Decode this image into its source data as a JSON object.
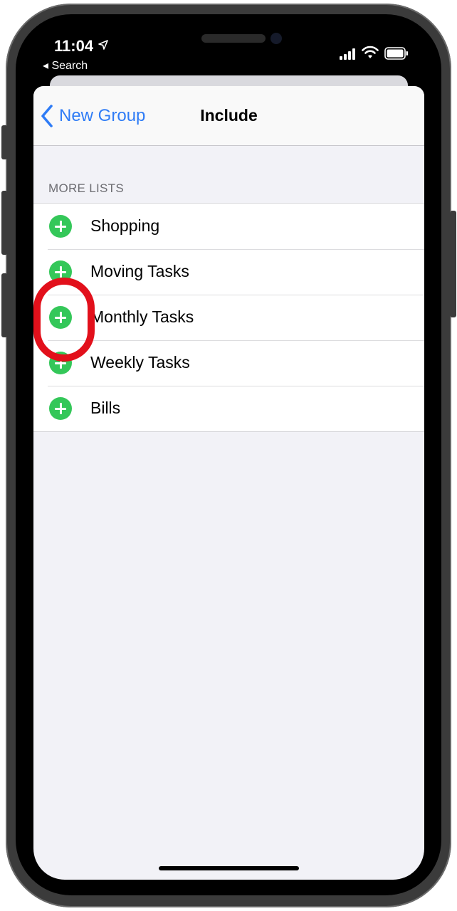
{
  "status_bar": {
    "time": "11:04",
    "back_app": "◂ Search"
  },
  "nav": {
    "back_label": "New Group",
    "title": "Include"
  },
  "section": {
    "header": "MORE LISTS"
  },
  "lists": [
    {
      "label": "Shopping"
    },
    {
      "label": "Moving Tasks"
    },
    {
      "label": "Monthly Tasks"
    },
    {
      "label": "Weekly Tasks"
    },
    {
      "label": "Bills"
    }
  ],
  "colors": {
    "accent": "#2f7cf6",
    "add": "#34c759",
    "highlight": "#e2101b",
    "background": "#f2f2f7"
  },
  "icons": {
    "back": "chevron-left-icon",
    "add": "plus-circle-icon",
    "location": "location-arrow-icon",
    "signal": "cellular-signal-icon",
    "wifi": "wifi-icon",
    "battery": "battery-icon"
  }
}
